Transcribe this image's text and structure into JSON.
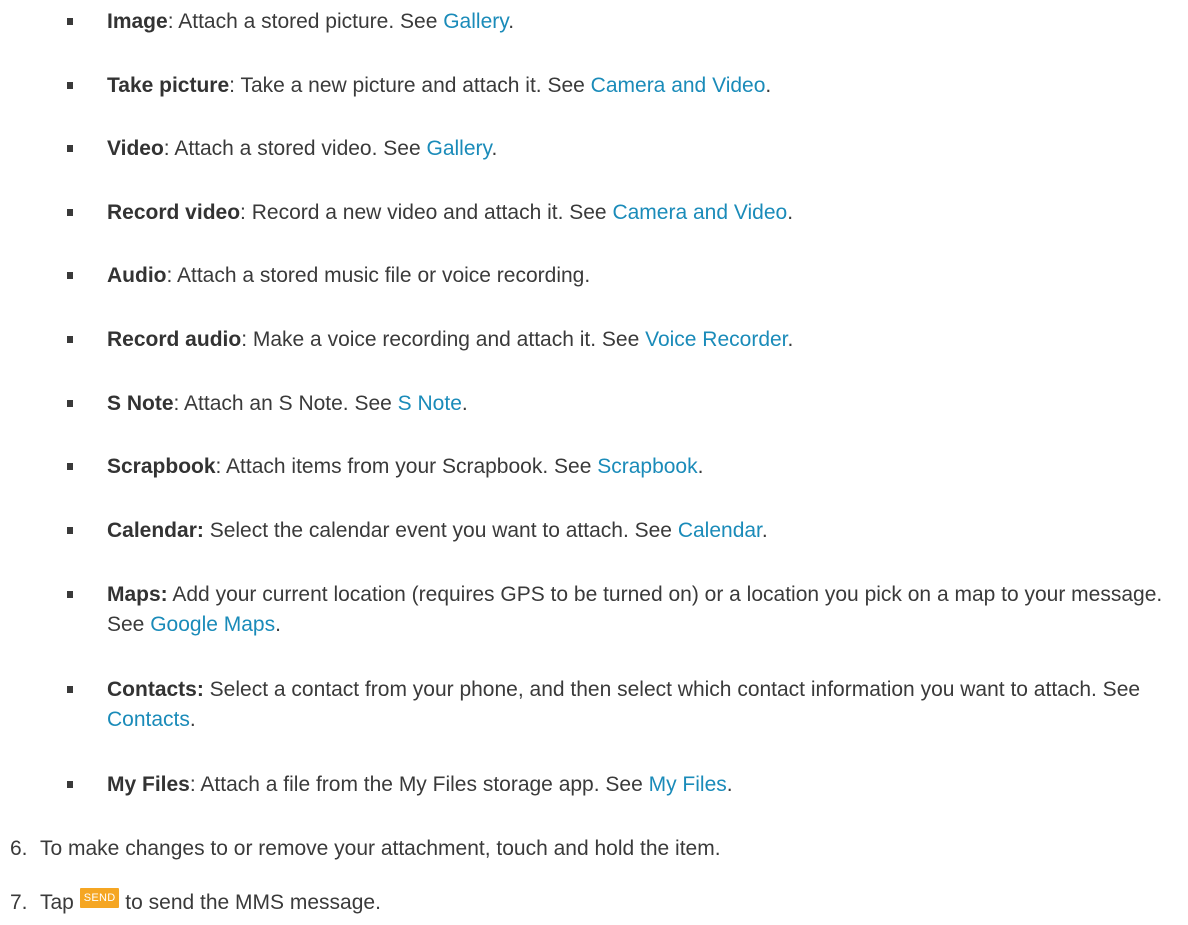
{
  "bullets": [
    {
      "term": "Image",
      "sep": ":",
      "text": " Attach a stored picture. See ",
      "link": "Gallery",
      "end": "."
    },
    {
      "term": "Take picture",
      "sep": ":",
      "text": " Take a new picture and attach it. See ",
      "link": "Camera and Video",
      "end": "."
    },
    {
      "term": "Video",
      "sep": ":",
      "text": " Attach a stored video. See ",
      "link": "Gallery",
      "end": "."
    },
    {
      "term": "Record video",
      "sep": ":",
      "text": " Record a new video and attach it. See ",
      "link": "Camera and Video",
      "end": "."
    },
    {
      "term": "Audio",
      "sep": ":",
      "text": " Attach a stored music file or voice recording.",
      "link": "",
      "end": ""
    },
    {
      "term": "Record audio",
      "sep": ":",
      "text": " Make a voice recording and attach it. See ",
      "link": "Voice Recorder",
      "end": "."
    },
    {
      "term": "S Note",
      "sep": ":",
      "text": " Attach an S Note. See ",
      "link": "S Note",
      "end": "."
    },
    {
      "term": "Scrapbook",
      "sep": ":",
      "text": " Attach items from your Scrapbook. See ",
      "link": "Scrapbook",
      "end": "."
    },
    {
      "term": "Calendar:",
      "sep": "",
      "text": " Select the calendar event you want to attach. See ",
      "link": "Calendar",
      "end": "."
    },
    {
      "term": "Maps:",
      "sep": "",
      "text": " Add your current location (requires GPS to be turned on) or a location you pick on a map to your message. See ",
      "link": "Google Maps",
      "end": "."
    },
    {
      "term": "Contacts:",
      "sep": "",
      "text": " Select a contact from your phone, and then select which contact information you want to attach. See ",
      "link": "Contacts",
      "end": "."
    },
    {
      "term": "My Files",
      "sep": ":",
      "text": " Attach a file from the My Files storage app. See ",
      "link": "My Files",
      "end": "."
    }
  ],
  "steps": [
    {
      "num": "6.",
      "text": "To make changes to or remove your attachment, touch and hold the item."
    },
    {
      "num": "7.",
      "before": "Tap ",
      "badge": "SEND",
      "after": " to send the MMS message."
    }
  ],
  "colors": {
    "link": "#1a8bb9",
    "badge": "#f5a623",
    "text": "#3a3a3a"
  }
}
